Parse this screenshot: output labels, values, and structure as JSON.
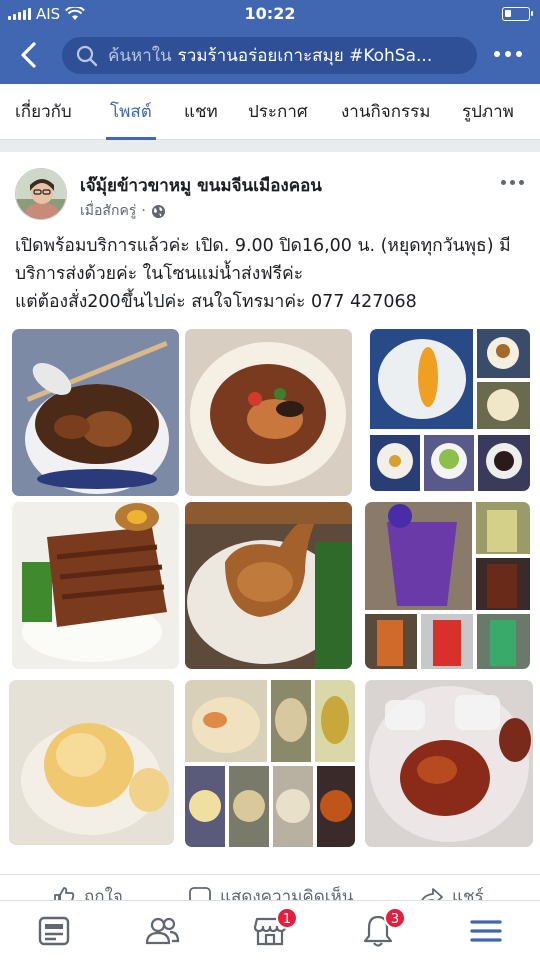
{
  "status_bar": {
    "carrier": "AIS",
    "time": "10:22"
  },
  "header": {
    "search_placeholder": "ค้นหาใน",
    "search_value": "รวมร้านอร่อยเกาะสมุย #KohSa..."
  },
  "tabs": [
    {
      "label": "เกี่ยวกับ",
      "active": false
    },
    {
      "label": "โพสต์",
      "active": true
    },
    {
      "label": "แชท",
      "active": false
    },
    {
      "label": "ประกาศ",
      "active": false
    },
    {
      "label": "งานกิจกรรม",
      "active": false
    },
    {
      "label": "รูปภาพ",
      "active": false
    }
  ],
  "post": {
    "author": "เจ๊มุ้ยข้าวขาหมู ขนมจีนเมืองคอน",
    "time": "เมื่อสักครู่",
    "privacy_icon": "globe-icon",
    "text_lines": [
      "เปิดพร้อมบริการแล้วค่ะ เปิด. 9.00 ปิด16,00 น. (หยุดทุกวันพุธ) มี",
      "บริการส่งด้วยค่ะ ในโซนแม่น้ำส่งฟรีค่ะ",
      "แต่ต้องสั่ง200ขึ้นไปค่ะ สนใจโทรมาค่ะ 077 427068"
    ],
    "photos": [
      "braised-pork-noodle-bowl",
      "noodle-soup-bowl",
      "dessert-collage",
      "braised-pork-leg-on-rice",
      "braised-chicken-on-rice",
      "butterfly-pea-drinks-collage",
      "dumpling-dessert",
      "kanom-jeen-collage",
      "sweet-potato-in-syrup-with-ice"
    ],
    "actions": {
      "like": "ถูกใจ",
      "comment": "แสดงความคิดเห็น",
      "share": "แชร์"
    }
  },
  "bottom_nav": {
    "items": [
      "news-feed-icon",
      "groups-icon",
      "marketplace-icon",
      "notifications-icon",
      "menu-icon"
    ],
    "marketplace_badge": "1",
    "notifications_badge": "3"
  },
  "colors": {
    "brand": "#4267b2",
    "badge": "#e41e3f"
  }
}
